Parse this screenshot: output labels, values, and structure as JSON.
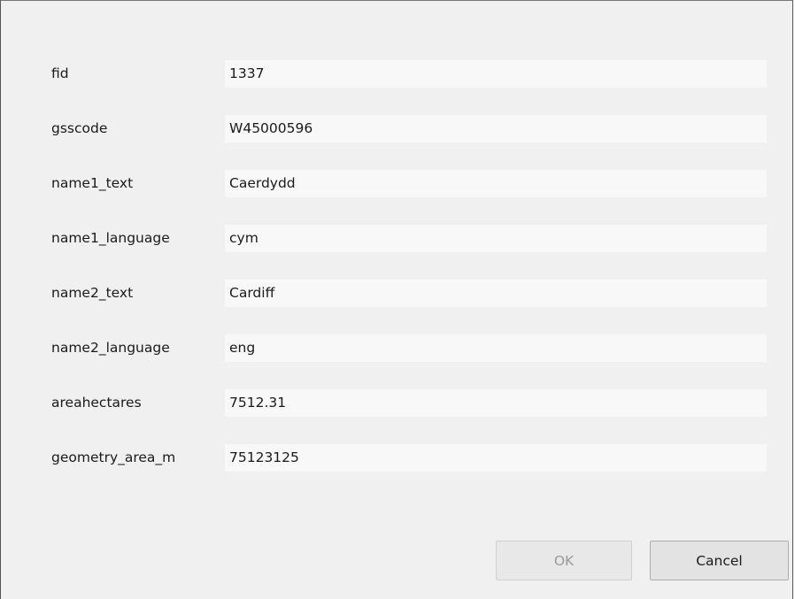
{
  "fields": [
    {
      "label": "fid",
      "value": "1337"
    },
    {
      "label": "gsscode",
      "value": "W45000596"
    },
    {
      "label": "name1_text",
      "value": "Caerdydd"
    },
    {
      "label": "name1_language",
      "value": "cym"
    },
    {
      "label": "name2_text",
      "value": "Cardiff"
    },
    {
      "label": "name2_language",
      "value": "eng"
    },
    {
      "label": "areahectares",
      "value": "7512.31"
    },
    {
      "label": "geometry_area_m",
      "value": "75123125"
    }
  ],
  "buttons": {
    "ok_label": "OK",
    "ok_enabled": false,
    "cancel_label": "Cancel"
  }
}
